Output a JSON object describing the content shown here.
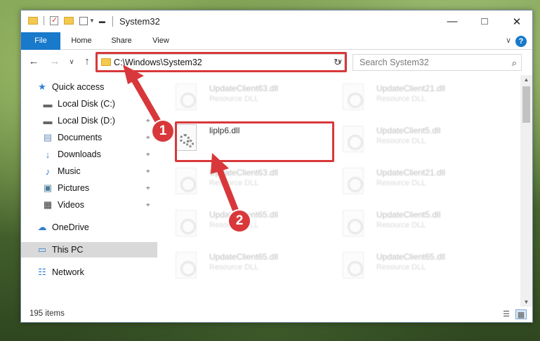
{
  "window": {
    "title": "System32"
  },
  "ribbon": {
    "tabs": [
      {
        "label": "File"
      },
      {
        "label": "Home"
      },
      {
        "label": "Share"
      },
      {
        "label": "View"
      }
    ],
    "help": "?",
    "expand": "∨"
  },
  "controls": {
    "minimize": "—",
    "maximize": "□",
    "close": "✕"
  },
  "nav": {
    "back": "←",
    "forward": "→",
    "recent": "∨",
    "up": "↑"
  },
  "address": {
    "path": "C:\\Windows\\System32",
    "dropdown": "∨",
    "refresh": "↻"
  },
  "search": {
    "placeholder": "Search System32",
    "icon": "⌕"
  },
  "sidebar": {
    "items": [
      {
        "label": "Quick access",
        "icon": "star-icon",
        "glyph": "★"
      },
      {
        "label": "Local Disk (C:)",
        "icon": "drive-icon",
        "glyph": "▬",
        "pinned": true
      },
      {
        "label": "Local Disk (D:)",
        "icon": "drive-icon",
        "glyph": "▬",
        "pinned": true
      },
      {
        "label": "Documents",
        "icon": "documents-icon",
        "glyph": "▤",
        "pinned": true
      },
      {
        "label": "Downloads",
        "icon": "download-icon",
        "glyph": "↓",
        "pinned": true
      },
      {
        "label": "Music",
        "icon": "music-icon",
        "glyph": "♪",
        "pinned": true
      },
      {
        "label": "Pictures",
        "icon": "pictures-icon",
        "glyph": "▣",
        "pinned": true
      },
      {
        "label": "Videos",
        "icon": "videos-icon",
        "glyph": "▦",
        "pinned": true
      },
      {
        "label": "OneDrive",
        "icon": "cloud-icon",
        "glyph": "☁"
      },
      {
        "label": "This PC",
        "icon": "computer-icon",
        "glyph": "▭",
        "selected": true
      },
      {
        "label": "Network",
        "icon": "network-icon",
        "glyph": "☷"
      }
    ],
    "pin_glyph": "⌖"
  },
  "files": {
    "left_column": [
      {
        "name": "UpdateClient63.dll",
        "type": "Resource DLL"
      },
      {
        "name": "liplp6.dll",
        "type": ""
      },
      {
        "name": "UpdateClient63.dll",
        "type": "Resource DLL"
      },
      {
        "name": "UpdateClient65.dll",
        "type": "Resource DLL"
      },
      {
        "name": "UpdateClient65.dll",
        "type": "Resource DLL"
      }
    ],
    "right_column": [
      {
        "name": "UpdateClient21.dll",
        "type": "Resource DLL"
      },
      {
        "name": "UpdateClient5.dll",
        "type": "Resource DLL"
      },
      {
        "name": "UpdateClient21.dll",
        "type": "Resource DLL"
      },
      {
        "name": "UpdateClient5.dll",
        "type": "Resource DLL"
      },
      {
        "name": "UpdateClient65.dll",
        "type": "Resource DLL"
      }
    ]
  },
  "status": {
    "item_count": "195 items"
  },
  "annotations": {
    "step1": "1",
    "step2": "2",
    "color": "#d8383b"
  }
}
